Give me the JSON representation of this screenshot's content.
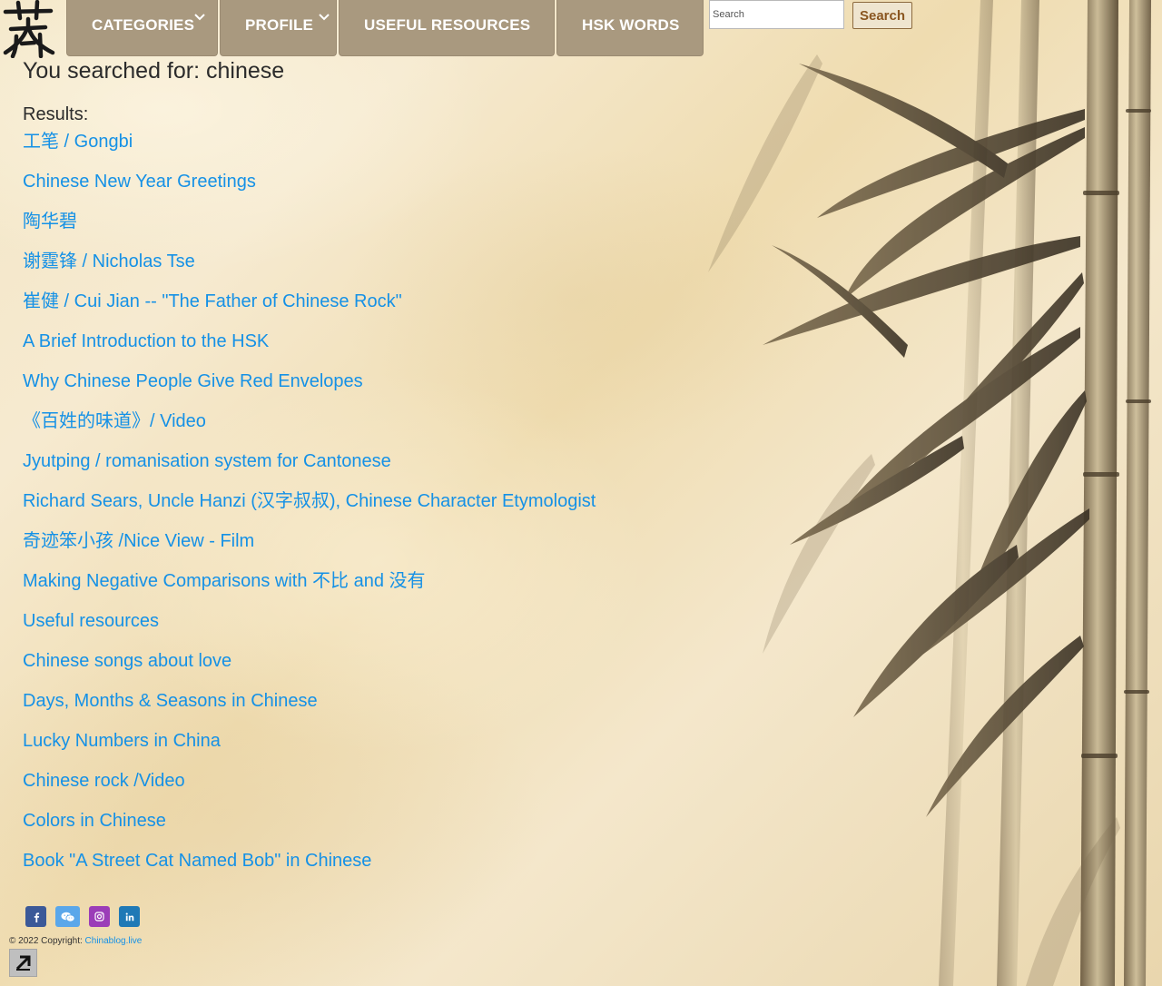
{
  "nav": {
    "categories_label": "CATEGORIES",
    "profile_label": "PROFILE",
    "resources_label": "USEFUL RESOURCES",
    "hsk_label": "HSK WORDS"
  },
  "search": {
    "placeholder": "Search",
    "button_label": "Search"
  },
  "main": {
    "title": "You searched for: chinese",
    "results_label": "Results:",
    "results": [
      "工笔 / Gongbi",
      "Chinese New Year Greetings",
      "陶华碧",
      "谢霆锋 / Nicholas Tse",
      "崔健 / Cui Jian -- \"The Father of Chinese Rock\"",
      "A Brief Introduction to the HSK",
      "Why Chinese People Give Red Envelopes",
      "《百姓的味道》/ Video",
      "Jyutping / romanisation system for Cantonese",
      "Richard Sears, Uncle Hanzi (汉字叔叔), Chinese Character Etymologist",
      "奇迹笨小孩 /Nice View - Film",
      "Making Negative Comparisons with 不比 and 没有",
      "Useful resources",
      "Chinese songs about love",
      "Days, Months & Seasons in Chinese",
      "Lucky Numbers in China",
      "Chinese rock /Video",
      "Colors in Chinese",
      "Book \"A Street Cat Named Bob\" in Chinese"
    ]
  },
  "footer": {
    "social_icons": [
      "facebook-icon",
      "wechat-icon",
      "instagram-icon",
      "linkedin-icon"
    ],
    "copyright_prefix": "© 2022 Copyright:",
    "copyright_link": "Chinablog.live"
  },
  "colors": {
    "nav_bg": "#a9997f",
    "link": "#1591e6",
    "facebook": "#3b5998",
    "wechat": "#5aa7ea",
    "instagram": "#9b3db8",
    "linkedin": "#1f79b6"
  }
}
